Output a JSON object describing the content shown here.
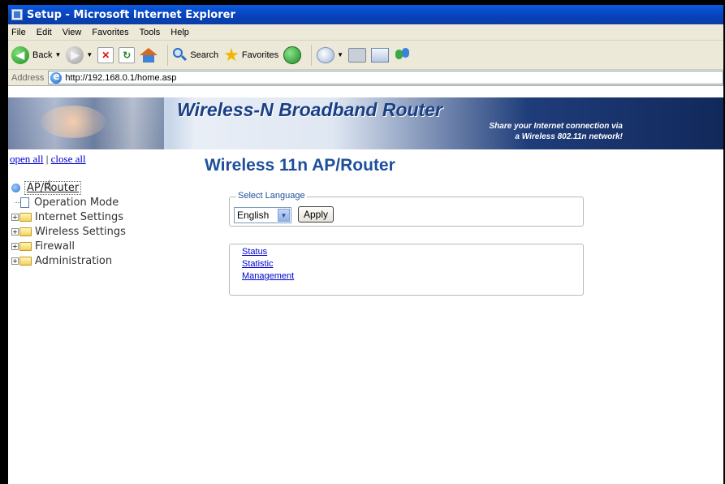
{
  "window": {
    "title": "Setup - Microsoft Internet Explorer"
  },
  "menu": [
    "File",
    "Edit",
    "View",
    "Favorites",
    "Tools",
    "Help"
  ],
  "toolbar": {
    "back_label": "Back",
    "search_label": "Search",
    "favorites_label": "Favorites"
  },
  "address": {
    "label": "Address",
    "url": "http://192.168.0.1/home.asp"
  },
  "banner": {
    "title": "Wireless-N Broadband Router",
    "tagline_line1": "Share your Internet connection via",
    "tagline_line2": "a Wireless 802.11n network!"
  },
  "tree": {
    "open_all": "open all",
    "separator": " | ",
    "close_all": "close all",
    "root": "AP/Router",
    "items": [
      "Operation Mode",
      "Internet Settings",
      "Wireless Settings",
      "Firewall",
      "Administration"
    ]
  },
  "main": {
    "heading": "Wireless 11n AP/Router",
    "language": {
      "legend": "Select Language",
      "selected": "English",
      "apply_label": "Apply"
    },
    "links": [
      "Status",
      "Statistic",
      "Management"
    ]
  },
  "icons": {
    "back": "back-arrow-icon",
    "forward": "forward-arrow-icon",
    "stop": "stop-icon",
    "refresh": "refresh-icon",
    "home": "home-icon",
    "search": "search-icon",
    "favorites": "star-icon",
    "history": "history-icon",
    "mail": "mail-icon",
    "print": "print-icon",
    "edit": "edit-icon",
    "messenger": "messenger-icon"
  },
  "colors": {
    "heading_blue": "#1e4f9c",
    "link_blue": "#0000cc",
    "titlebar_blue": "#0841b8"
  }
}
